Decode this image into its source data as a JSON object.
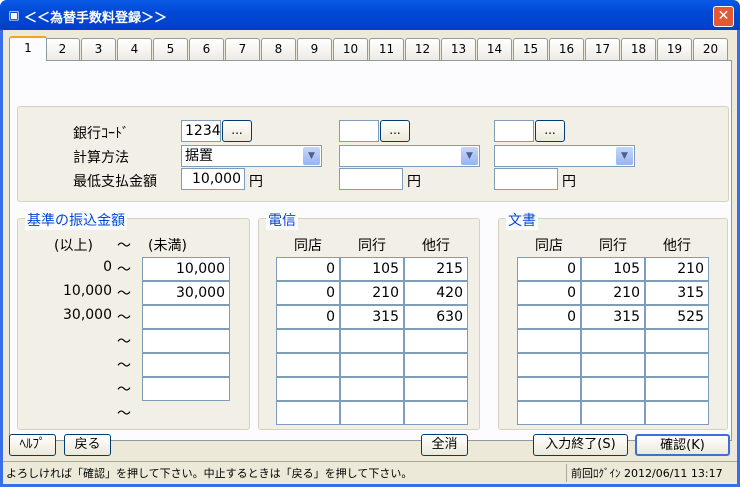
{
  "window": {
    "title": "＜＜為替手数料登録＞＞",
    "close_icon": "close-icon",
    "title_icon": "app-icon"
  },
  "tabs": [
    "1",
    "2",
    "3",
    "4",
    "5",
    "6",
    "7",
    "8",
    "9",
    "10",
    "11",
    "12",
    "13",
    "14",
    "15",
    "16",
    "17",
    "18",
    "19",
    "20"
  ],
  "top": {
    "bank_code_label": "銀行ｺｰﾄﾞ",
    "calc_method_label": "計算方法",
    "min_amount_label": "最低支払金額",
    "ellipsis": "...",
    "yen": "円",
    "col1": {
      "bank_code": "1234",
      "calc_method": "据置",
      "min_amount": "10,000"
    },
    "col2": {
      "bank_code": "",
      "calc_method": "",
      "min_amount": ""
    },
    "col3": {
      "bank_code": "",
      "calc_method": "",
      "min_amount": ""
    }
  },
  "base": {
    "legend": "基準の振込金額",
    "from_header": "(以上)",
    "tilde": "～",
    "to_header": "(未満)",
    "rows": [
      {
        "from": "0",
        "to": "10,000"
      },
      {
        "from": "10,000",
        "to": "30,000"
      },
      {
        "from": "30,000",
        "to": ""
      },
      {
        "from": "",
        "to": ""
      },
      {
        "from": "",
        "to": ""
      },
      {
        "from": "",
        "to": ""
      },
      {
        "from": "",
        "to": null
      }
    ]
  },
  "telegraph": {
    "legend": "電信",
    "headers": [
      "同店",
      "同行",
      "他行"
    ],
    "rows": [
      [
        "0",
        "105",
        "215"
      ],
      [
        "0",
        "210",
        "420"
      ],
      [
        "0",
        "315",
        "630"
      ],
      [
        "",
        "",
        ""
      ],
      [
        "",
        "",
        ""
      ],
      [
        "",
        "",
        ""
      ],
      [
        "",
        "",
        ""
      ]
    ]
  },
  "document": {
    "legend": "文書",
    "headers": [
      "同店",
      "同行",
      "他行"
    ],
    "rows": [
      [
        "0",
        "105",
        "210"
      ],
      [
        "0",
        "210",
        "315"
      ],
      [
        "0",
        "315",
        "525"
      ],
      [
        "",
        "",
        ""
      ],
      [
        "",
        "",
        ""
      ],
      [
        "",
        "",
        ""
      ],
      [
        "",
        "",
        ""
      ]
    ]
  },
  "buttons": {
    "help": "ﾍﾙﾌﾟ",
    "back": "戻る",
    "clear": "全消",
    "input_end": "入力終了(S)",
    "confirm": "確認(K)"
  },
  "status": {
    "message": "よろしければ「確認」を押して下さい。中止するときは「戻る」を押して下さい。",
    "login": "前回ﾛｸﾞｲﾝ 2012/06/11 13:17"
  }
}
